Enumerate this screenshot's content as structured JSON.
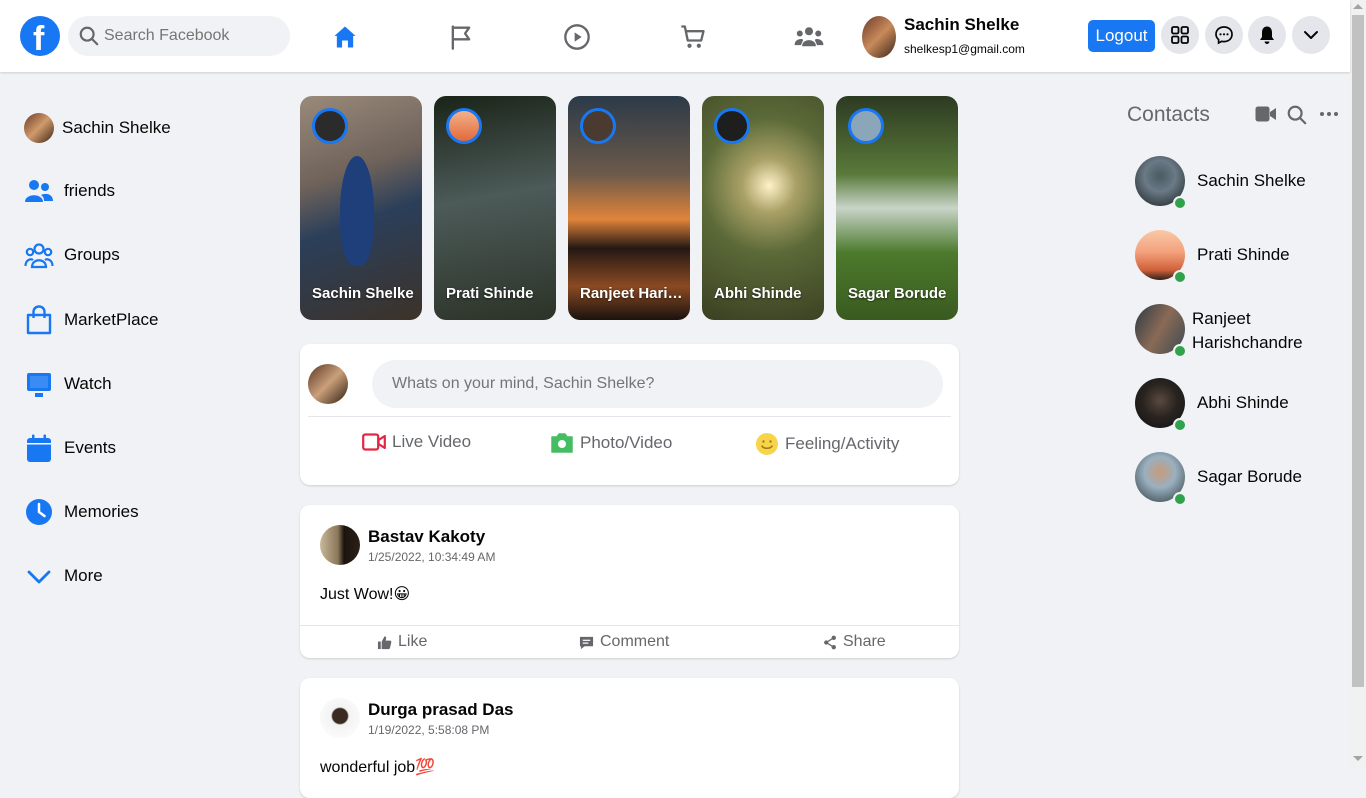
{
  "header": {
    "logo_letter": "f",
    "search_placeholder": "Search Facebook",
    "nav": [
      {
        "icon": "home-icon",
        "active": true
      },
      {
        "icon": "flag-icon",
        "active": false
      },
      {
        "icon": "watch-play-icon",
        "active": false
      },
      {
        "icon": "marketplace-cart-icon",
        "active": false
      },
      {
        "icon": "groups-icon",
        "active": false
      }
    ],
    "profile": {
      "name": "Sachin Shelke",
      "email": "shelkesp1@gmail.com"
    },
    "logout_label": "Logout",
    "right_buttons": [
      "menu-grid-icon",
      "messenger-icon",
      "notifications-bell-icon",
      "account-chevron-icon"
    ]
  },
  "sidebar": {
    "profile_name": "Sachin Shelke",
    "items": [
      {
        "label": "friends",
        "icon": "friends-icon"
      },
      {
        "label": "Groups",
        "icon": "groups-icon"
      },
      {
        "label": "MarketPlace",
        "icon": "marketplace-bag-icon"
      },
      {
        "label": "Watch",
        "icon": "watch-tv-icon"
      },
      {
        "label": "Events",
        "icon": "events-calendar-icon"
      },
      {
        "label": "Memories",
        "icon": "memories-clock-icon"
      },
      {
        "label": "More",
        "icon": "chevron-down-icon"
      }
    ]
  },
  "stories": [
    {
      "name": "Sachin Shelke"
    },
    {
      "name": "Prati Shinde"
    },
    {
      "name": "Ranjeet Harishchandre"
    },
    {
      "name": "Abhi Shinde"
    },
    {
      "name": "Sagar Borude"
    }
  ],
  "composer": {
    "placeholder": "Whats on your mind, Sachin Shelke?",
    "live_video": "Live Video",
    "photo_video": "Photo/Video",
    "feeling": "Feeling/Activity"
  },
  "posts": [
    {
      "author": "Bastav Kakoty",
      "time": "1/25/2022, 10:34:49 AM",
      "text": "Just Wow!😀"
    },
    {
      "author": "Durga prasad Das",
      "time": "1/19/2022, 5:58:08 PM",
      "text": "wonderful job💯"
    }
  ],
  "post_actions": {
    "like": "Like",
    "comment": "Comment",
    "share": "Share"
  },
  "contacts": {
    "title": "Contacts",
    "people": [
      {
        "name": "Sachin Shelke",
        "online": true
      },
      {
        "name": "Prati Shinde",
        "online": true
      },
      {
        "name": "Ranjeet Harishchandre",
        "line1": "Ranjeet",
        "line2": "Harishchandre",
        "online": true
      },
      {
        "name": "Abhi Shinde",
        "online": true
      },
      {
        "name": "Sagar Borude",
        "online": true
      }
    ]
  },
  "colors": {
    "accent": "#1877f2",
    "online": "#31a24c",
    "background": "#f0f2f5"
  }
}
